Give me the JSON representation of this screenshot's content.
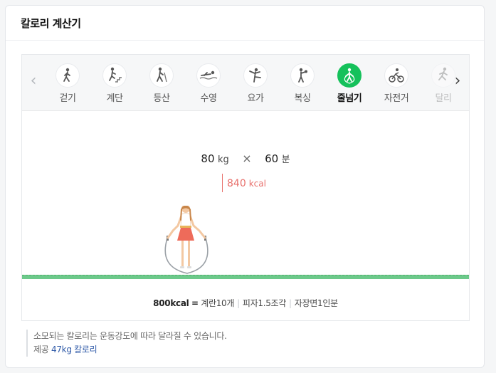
{
  "card": {
    "title": "칼로리 계산기"
  },
  "tabs": [
    {
      "label": "걷기",
      "icon": "walking-icon"
    },
    {
      "label": "계단",
      "icon": "stairs-icon"
    },
    {
      "label": "등산",
      "icon": "hiking-icon"
    },
    {
      "label": "수영",
      "icon": "swimming-icon"
    },
    {
      "label": "요가",
      "icon": "yoga-icon"
    },
    {
      "label": "복싱",
      "icon": "boxing-icon"
    },
    {
      "label": "줄넘기",
      "icon": "jump-rope-icon",
      "active": true
    },
    {
      "label": "자전거",
      "icon": "bicycle-icon"
    },
    {
      "label": "달리",
      "icon": "running-icon"
    }
  ],
  "calc": {
    "weight_value": "80",
    "weight_unit": "kg",
    "times": "×",
    "minutes_value": "60",
    "minutes_unit": "분",
    "result_value": "840",
    "result_unit": "kcal"
  },
  "equivalents": {
    "kcal": "800kcal",
    "equals": "=",
    "items": [
      "계란10개",
      "피자1.5조각",
      "자장면1인분"
    ]
  },
  "notes": {
    "line1": "소모되는 칼로리는 운동강도에 따라 달라질 수 있습니다.",
    "source_prefix": "제공",
    "source_link": "47kg 칼로리"
  },
  "colors": {
    "accent": "#15c15b",
    "result": "#e8706c",
    "ground": "#6cc98a",
    "link": "#2f5aa8"
  }
}
